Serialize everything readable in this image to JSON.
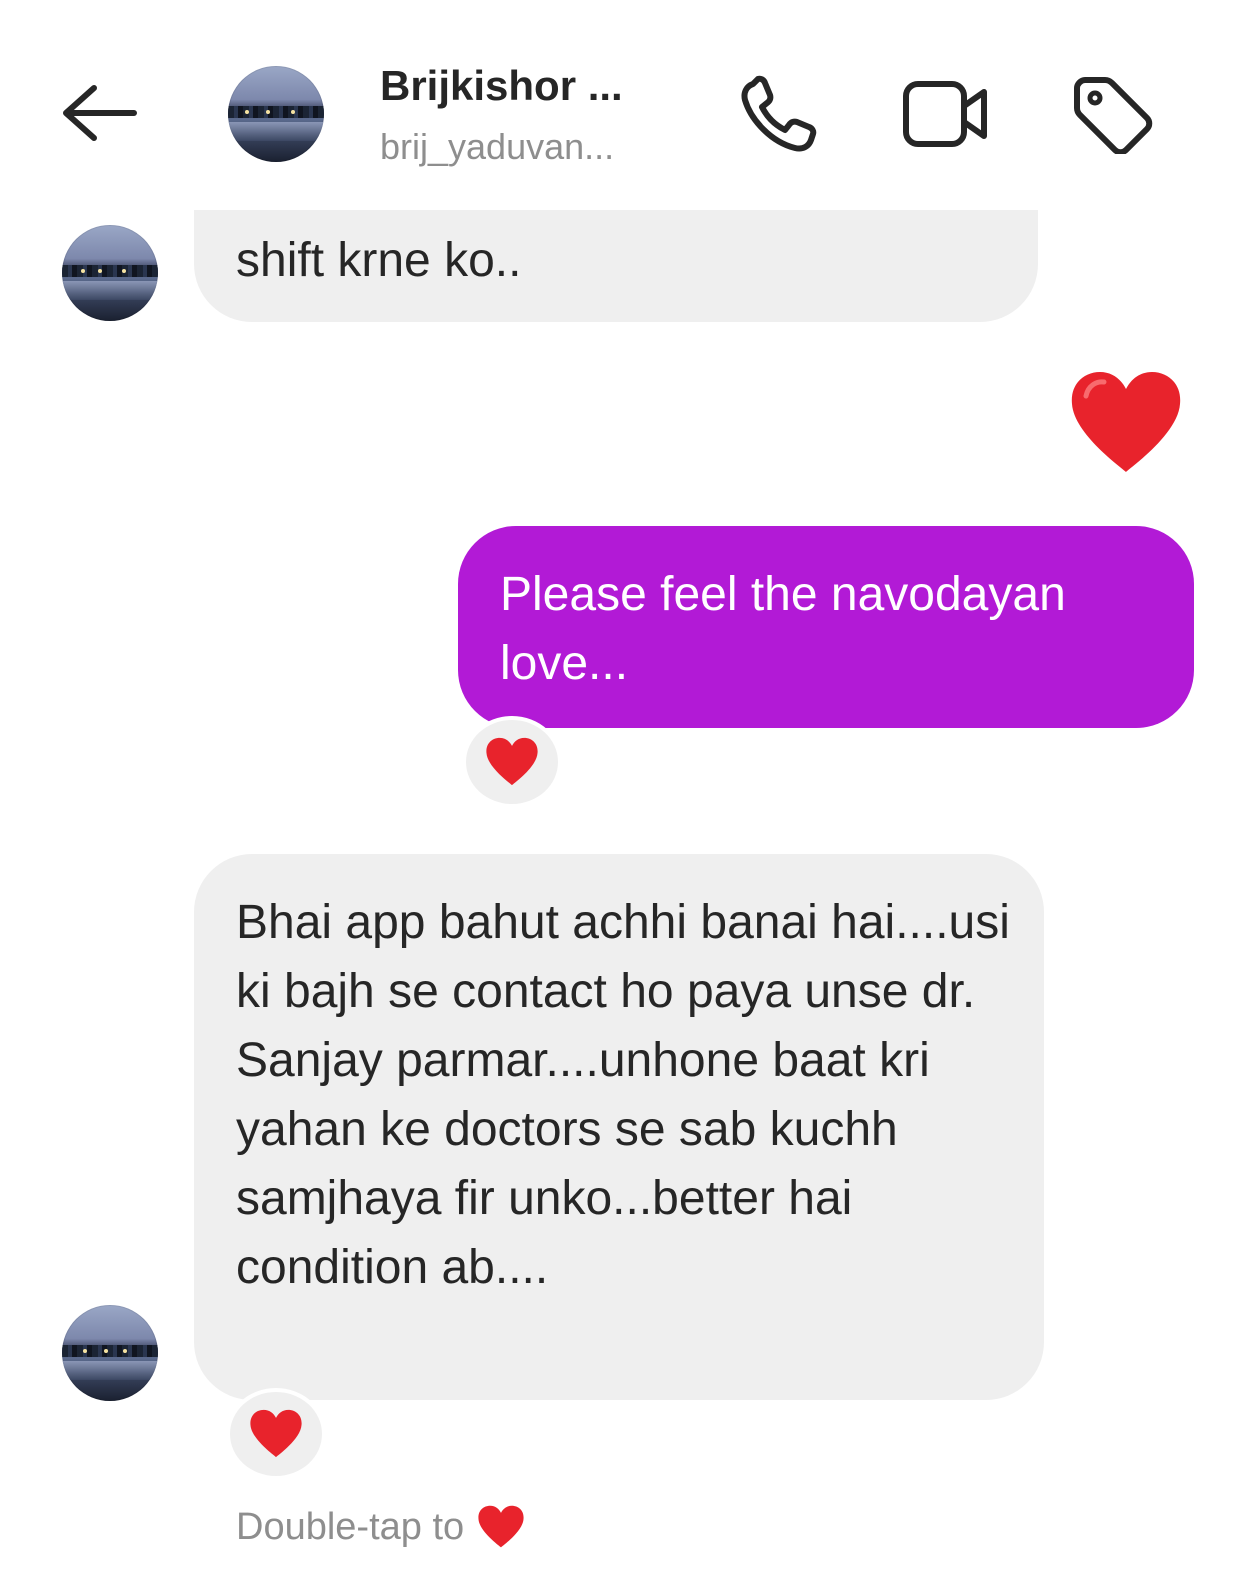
{
  "header": {
    "title": "Brijkishor ...",
    "subtitle": "brij_yaduvan...",
    "back_icon": "arrow-left-icon",
    "call_icon": "phone-icon",
    "video_icon": "video-camera-icon",
    "tag_icon": "tag-icon"
  },
  "messages": [
    {
      "sender": "contact",
      "text": "shift krne ko.."
    },
    {
      "sender": "me",
      "type": "heart-emoji",
      "icon": "heart-icon"
    },
    {
      "sender": "me",
      "text": "Please feel the navodayan love...",
      "reaction": "heart-icon"
    },
    {
      "sender": "contact",
      "text": "Bhai app bahut achhi banai hai....usi ki bajh se contact ho paya unse dr. Sanjay parmar....unhone baat kri yahan ke doctors se sab kuchh samjhaya fir unko...better hai condition ab....",
      "reaction": "heart-icon"
    }
  ],
  "hint": {
    "text": "Double-tap to",
    "icon": "heart-icon"
  },
  "colors": {
    "outgoing_bubble": "#b21ad6",
    "incoming_bubble": "#efefef",
    "heart": "#e8232c",
    "secondary_text": "#8e8e8e"
  }
}
